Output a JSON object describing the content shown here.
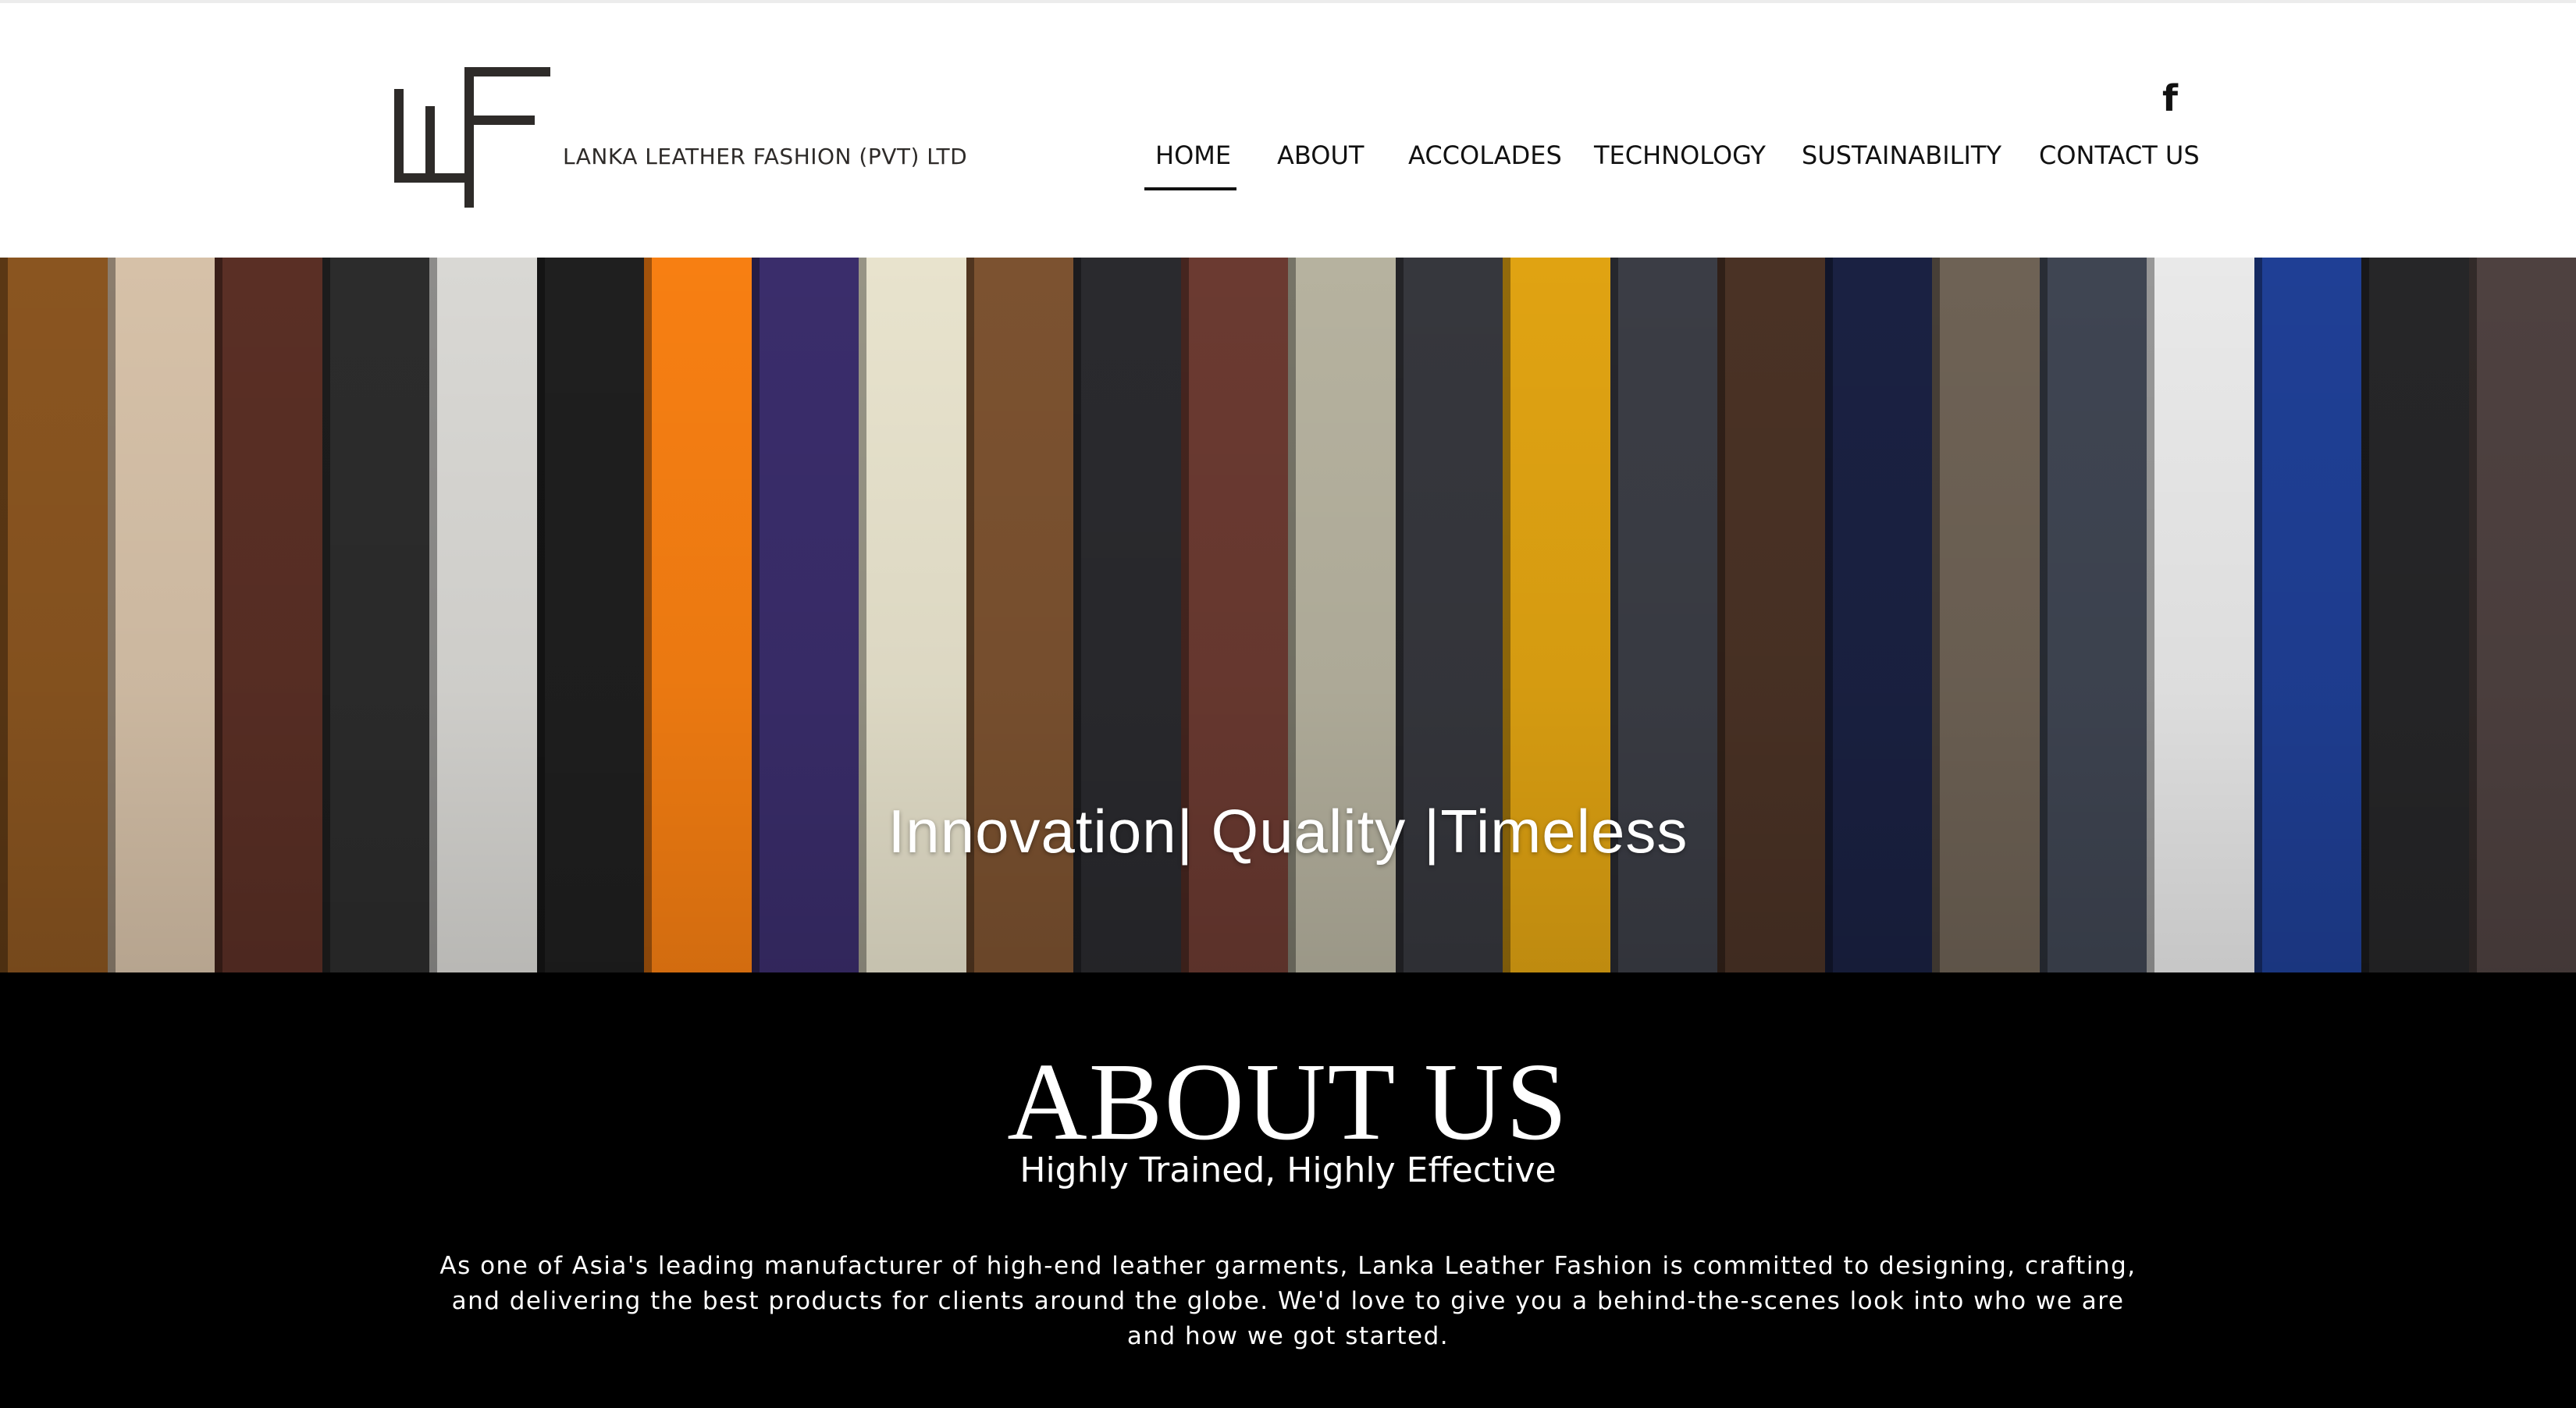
{
  "brand": {
    "company_name": "LANKA LEATHER FASHION (PVT) LTD",
    "logo_mark": "LLF",
    "logo_color": "#2e2b29"
  },
  "social": {
    "facebook_label": "f",
    "icon": "facebook-icon"
  },
  "nav": {
    "items": [
      {
        "label": "HOME",
        "active": true
      },
      {
        "label": "ABOUT",
        "active": false
      },
      {
        "label": "ACCOLADES",
        "active": false
      },
      {
        "label": "TECHNOLOGY",
        "active": false
      },
      {
        "label": "SUSTAINABILITY",
        "active": false
      },
      {
        "label": "CONTACT US",
        "active": false
      }
    ]
  },
  "hero": {
    "tagline": "Innovation| Quality |Timeless",
    "swatch_colors": [
      "#8a5520",
      "#d6c1a8",
      "#5a2f25",
      "#2c2c2c",
      "#d9d8d4",
      "#1f1f1f",
      "#f77f12",
      "#3a2d6b",
      "#e8e3cd",
      "#7c5230",
      "#2a2a2e",
      "#6b3a31",
      "#b6b29f",
      "#36373d",
      "#e0a312",
      "#3b3d45",
      "#4a3225",
      "#1a2142",
      "#6e6255",
      "#3f4552",
      "#e9e9e9",
      "#1f3f95",
      "#262628",
      "#4e4140"
    ]
  },
  "about": {
    "title": "ABOUT US",
    "subtitle": "Highly Trained, Highly Effective",
    "body": "As one of Asia's leading manufacturer of high-end leather garments, Lanka Leather Fashion is committed to designing, crafting, and delivering the best products for clients around the globe. We'd love to give you a behind-the-scenes look into who we are and how we got started."
  }
}
